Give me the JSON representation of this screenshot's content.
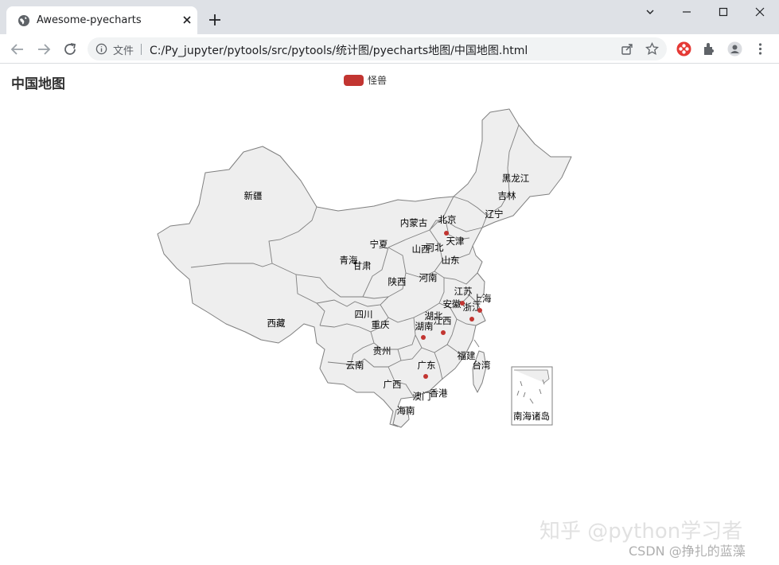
{
  "browser": {
    "tab_title": "Awesome-pyecharts",
    "scheme_label": "文件",
    "url": "C:/Py_jupyter/pytools/src/pytools/统计图/pyecharts地图/中国地图.html"
  },
  "chart": {
    "title": "中国地图",
    "legend": [
      "怪兽"
    ],
    "series_color": "#c23531",
    "region_fill": "#eeeeee",
    "region_border": "#7f7f7f",
    "inset_label": "南海诸岛"
  },
  "province_labels": {
    "heilongjiang": "黑龙江",
    "jilin": "吉林",
    "liaoning": "辽宁",
    "neimenggu": "内蒙古",
    "beijing": "北京",
    "tianjin": "天津",
    "hebei": "河北",
    "shanxi": "山西",
    "ningxia": "宁夏",
    "xinjiang": "新疆",
    "qinghai": "青海",
    "gansu": "甘肃",
    "shaanxi": "陕西",
    "shandong": "山东",
    "henan": "河南",
    "jiangsu": "江苏",
    "shanghai": "上海",
    "anhui": "安徽",
    "zhejiang": "浙江",
    "sichuan": "四川",
    "chongqing": "重庆",
    "hubei": "湖北",
    "hunan": "湖南",
    "jiangxi": "江西",
    "xizang": "西藏",
    "guizhou": "贵州",
    "yunnan": "云南",
    "fujian": "福建",
    "taiwan": "台湾",
    "guangdong": "广东",
    "guangxi": "广西",
    "xianggang": "香港",
    "aomen": "澳门",
    "hainan": "海南"
  },
  "map_data": {
    "series": "怪兽",
    "marked_regions": [
      "北京",
      "江苏",
      "浙江",
      "湖南",
      "江西",
      "广东"
    ]
  },
  "watermarks": {
    "zhihu": "知乎 @python学习者",
    "csdn": "CSDN @挣扎的蓝藻"
  }
}
